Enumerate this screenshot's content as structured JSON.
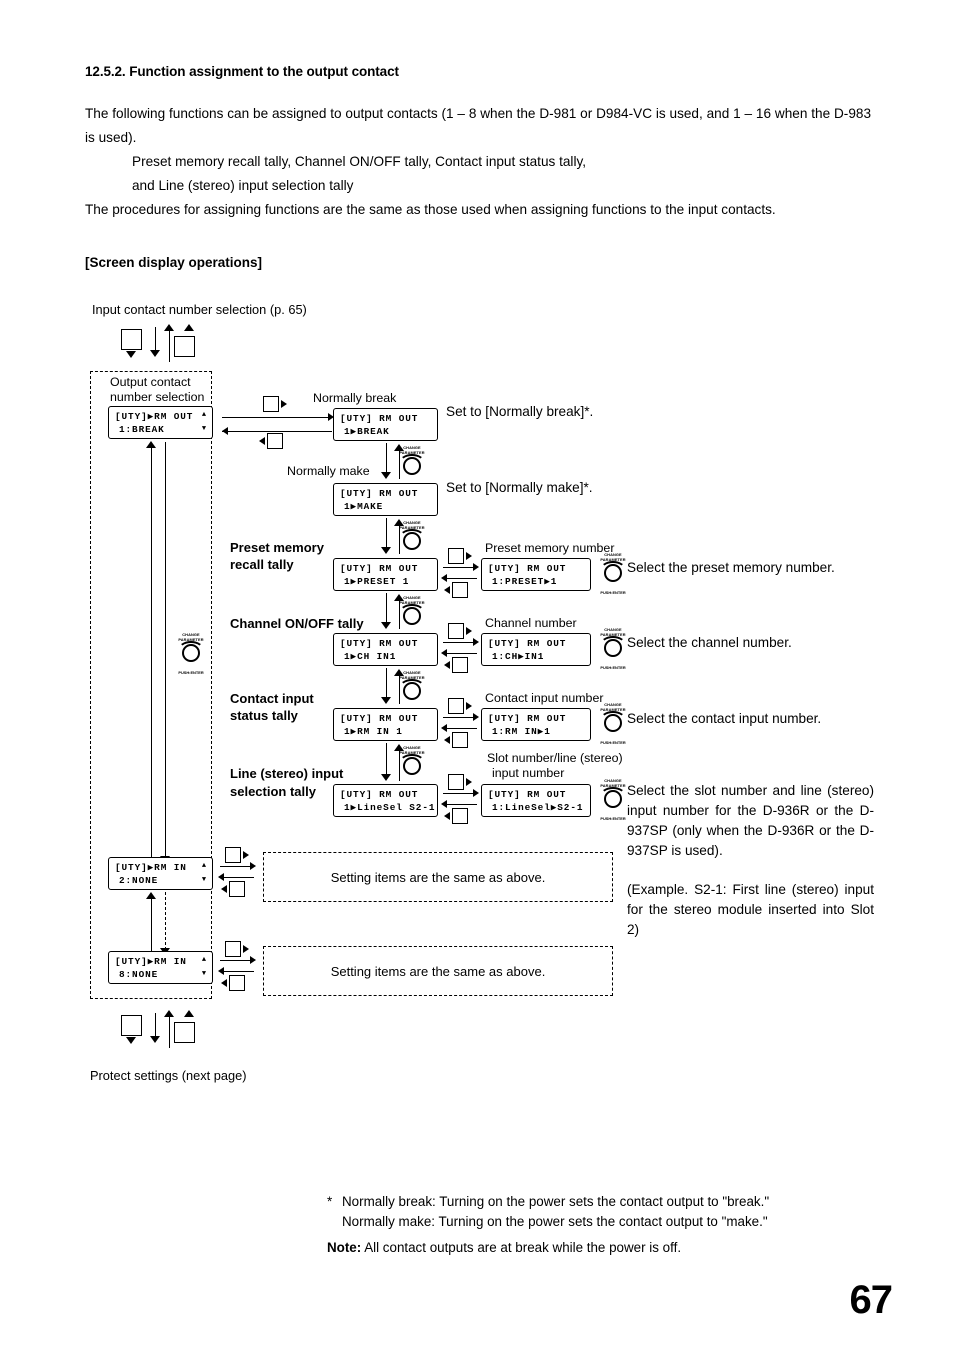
{
  "document": {
    "page_number": "67",
    "heading": "12.5.2. Function assignment to the output contact",
    "paragraphs": {
      "p1": "The following functions can be assigned to output contacts (1 – 8 when the D-981 or D984-VC is used, and 1 – 16 when the D-983 is used).",
      "p2": "Preset memory recall tally, Channel ON/OFF tally, Contact input status tally,",
      "p3": "and Line (stereo) input selection tally",
      "p4": "The procedures for assigning functions are the same as those used when assigning functions to the input contacts."
    },
    "screen_display_heading": "[Screen display operations]"
  },
  "diagram": {
    "top_link_label": "Input contact number selection (p. 65)",
    "bottom_link_label": "Protect settings (next page)",
    "output_contact_caption_line1": "Output contact",
    "output_contact_caption_line2": "number selection",
    "labels": {
      "normally_break": "Normally break",
      "normally_make": "Normally make",
      "preset_memory_number": "Preset memory number",
      "channel_number": "Channel number",
      "contact_input_number": "Contact input number",
      "slot_number_line1": "Slot number/line (stereo)",
      "slot_number_line2": "input number"
    },
    "row_titles": {
      "preset_recall_l1": "Preset memory",
      "preset_recall_l2": "recall tally",
      "channel_onoff": "Channel ON/OFF tally",
      "contact_status_l1": "Contact input",
      "contact_status_l2": "status tally",
      "line_stereo_l1": "Line (stereo) input",
      "line_stereo_l2": "selection tally"
    },
    "lcds": {
      "out_select": {
        "line1": "[UTY]▶RM OUT",
        "line2": "1:BREAK",
        "arrow_up": "▲",
        "arrow_down": "▼"
      },
      "break": {
        "line1": "[UTY] RM OUT",
        "line2": "1▶BREAK"
      },
      "make": {
        "line1": "[UTY] RM OUT",
        "line2": "1▶MAKE"
      },
      "preset": {
        "line1": "[UTY] RM OUT",
        "line2": "1▶PRESET 1"
      },
      "preset_num": {
        "line1": "[UTY] RM OUT",
        "line2": "1:PRESET▶1"
      },
      "ch": {
        "line1": "[UTY] RM OUT",
        "line2": "1▶CH IN1"
      },
      "ch_num": {
        "line1": "[UTY] RM OUT",
        "line2": "1:CH▶IN1"
      },
      "rmin": {
        "line1": "[UTY] RM OUT",
        "line2": "1▶RM IN 1"
      },
      "rmin_num": {
        "line1": "[UTY] RM OUT",
        "line2": "1:RM IN▶1"
      },
      "linesel": {
        "line1": "[UTY] RM OUT",
        "line2": "1▶LineSel S2-1"
      },
      "linesel_num": {
        "line1": "[UTY] RM OUT",
        "line2": "1:LineSel▶S2-1"
      },
      "rmin2": {
        "line1": "[UTY]▶RM IN",
        "line2": "2:NONE",
        "arrow_up": "▲",
        "arrow_down": "▼"
      },
      "rmin8": {
        "line1": "[UTY]▶RM IN",
        "line2": "8:NONE",
        "arrow_up": "▲",
        "arrow_down": "▼"
      }
    },
    "knob": {
      "caption_line1": "CHANGE",
      "caption_line2": "PARAMETER",
      "footer": "PUSH:ENTER"
    },
    "same_as_above": "Setting items are the same as above.",
    "instructions": {
      "break": "Set to [Normally break]*.",
      "make": "Set to [Normally make]*.",
      "preset": "Select the preset memory number.",
      "channel": "Select the channel number.",
      "contact": "Select the contact input number.",
      "line": "Select the slot number and line (stereo) input number for the D-936R or the D-937SP (only when the D-936R or the D-937SP is used).",
      "line_example": "(Example. S2-1: First line (stereo) input for the stereo module inserted into Slot 2)"
    }
  },
  "footnotes": {
    "star": "*",
    "line1": "Normally break:  Turning on the power sets the contact output to \"break.\"",
    "line2": "Normally make:  Turning on the power sets the contact output to \"make.\"",
    "note_label": "Note:",
    "note_text": " All contact outputs are at break while the power is off."
  }
}
